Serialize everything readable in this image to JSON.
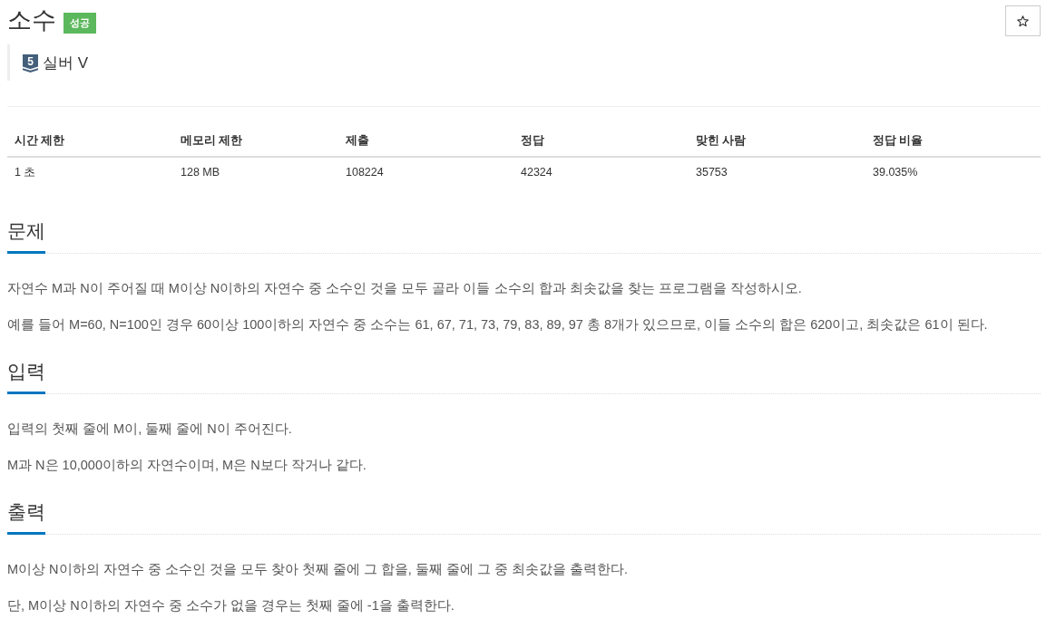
{
  "problem": {
    "title": "소수",
    "result_badge": {
      "label": "성공",
      "kind": "success"
    },
    "favorite": {
      "starred": false
    }
  },
  "tier": {
    "kind": "silver",
    "number": "5",
    "label": "실버 V"
  },
  "stats_table": {
    "columns": [
      "시간 제한",
      "메모리 제한",
      "제출",
      "정답",
      "맞힌 사람",
      "정답 비율"
    ],
    "rows": [
      [
        "1 초",
        "128 MB",
        "108224",
        "42324",
        "35753",
        "39.035%"
      ]
    ]
  },
  "sections": [
    {
      "heading": "문제",
      "paragraphs": [
        "자연수 M과 N이 주어질 때 M이상 N이하의 자연수 중 소수인 것을 모두 골라 이들 소수의 합과 최솟값을 찾는 프로그램을 작성하시오.",
        "예를 들어 M=60, N=100인 경우 60이상 100이하의 자연수 중 소수는 61, 67, 71, 73, 79, 83, 89, 97 총 8개가 있으므로, 이들 소수의 합은 620이고, 최솟값은 61이 된다."
      ]
    },
    {
      "heading": "입력",
      "paragraphs": [
        "입력의 첫째 줄에 M이, 둘째 줄에 N이 주어진다.",
        "M과 N은 10,000이하의 자연수이며, M은 N보다 작거나 같다."
      ]
    },
    {
      "heading": "출력",
      "paragraphs": [
        "M이상 N이하의 자연수 중 소수인 것을 모두 찾아 첫째 줄에 그 합을, 둘째 줄에 그 중 최솟값을 출력한다.",
        "단, M이상 N이하의 자연수 중 소수가 없을 경우는 첫째 줄에 -1을 출력한다."
      ]
    }
  ]
}
